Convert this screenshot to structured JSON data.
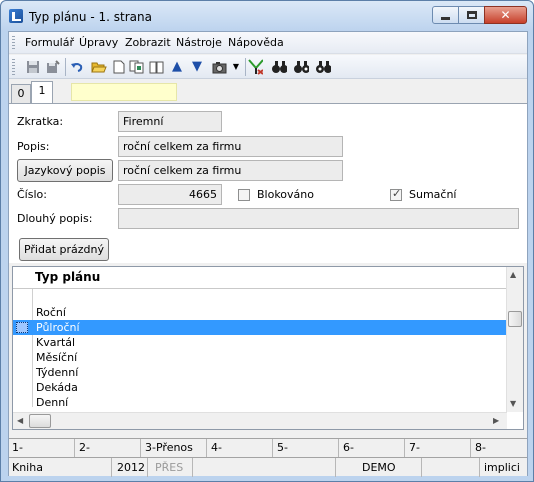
{
  "window": {
    "title": "Typ plánu - 1. strana"
  },
  "menu": [
    "Formulář",
    "Úpravy",
    "Zobrazit",
    "Nástroje",
    "Nápověda"
  ],
  "toolbar_icons": [
    "save-icon",
    "save-as-icon",
    "undo-icon",
    "open-folder-icon",
    "new-document-icon",
    "copy-icon",
    "book-icon",
    "arrow-up-icon",
    "arrow-down-icon",
    "camera-icon",
    "dropdown-icon",
    "filter-icon",
    "binoculars-icon",
    "binoculars-next-icon",
    "binoculars-prev-icon"
  ],
  "tabs": [
    {
      "label": "0",
      "active": false
    },
    {
      "label": "1",
      "active": true
    }
  ],
  "form": {
    "zkratka_label": "Zkratka:",
    "zkratka_value": "Firemní",
    "popis_label": "Popis:",
    "popis_value": "roční celkem za firmu",
    "jazykovy_button": "Jazykový popis",
    "jazykovy_value": "roční celkem za firmu",
    "cislo_label": "Číslo:",
    "cislo_value": "4665",
    "blokovano_label": "Blokováno",
    "blokovano_checked": false,
    "sumacni_label": "Sumační",
    "sumacni_checked": true,
    "dlouhy_label": "Dlouhý popis:",
    "dlouhy_value": "",
    "pridat_button": "Přidat prázdný"
  },
  "grid": {
    "header": "Typ plánu",
    "rows": [
      "Roční",
      "Půlroční",
      "Kvartál",
      "Měsíční",
      "Týdenní",
      "Dekáda",
      "Denní"
    ],
    "selected_index": 1
  },
  "fkeys": [
    "1-",
    "2-",
    "3-Přenos",
    "4-",
    "5-",
    "6-",
    "7-",
    "8-"
  ],
  "status": {
    "module": "Kniha",
    "year": "2012",
    "pres": "PŘES",
    "db": "DEMO",
    "mode": "implici"
  }
}
